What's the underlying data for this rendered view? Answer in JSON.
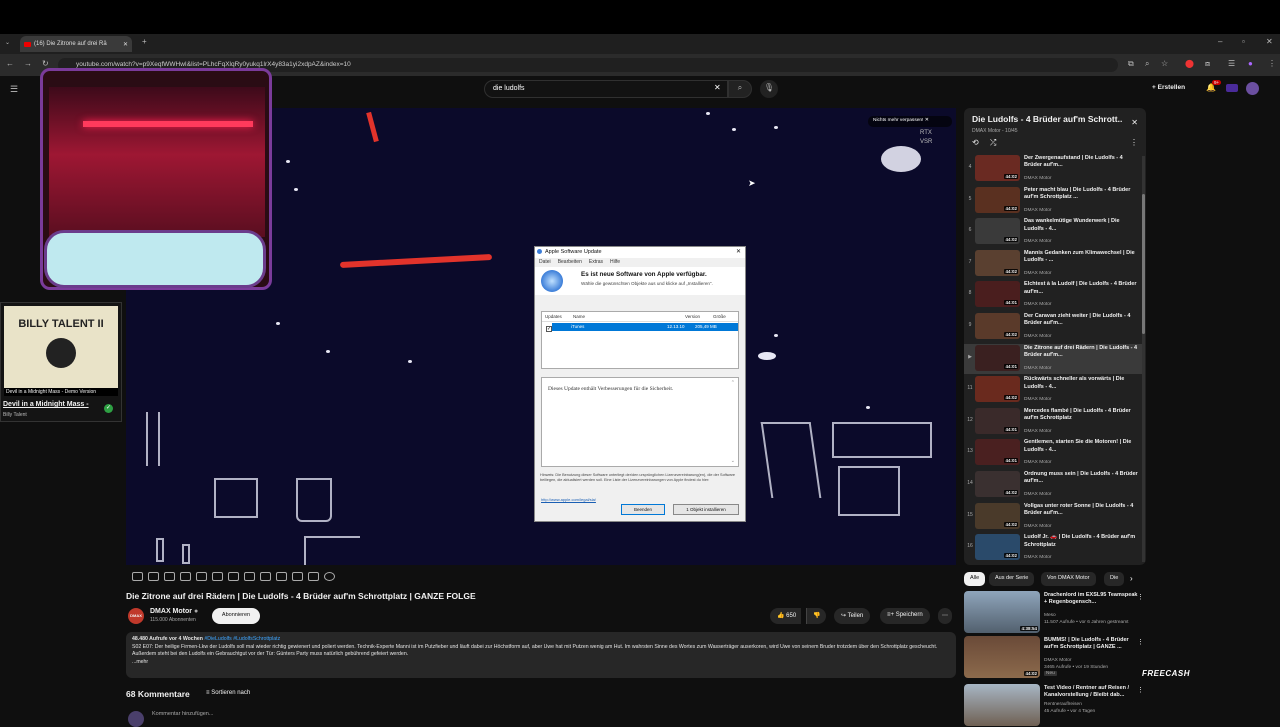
{
  "browser": {
    "tab_title": "(16) Die Zitrone auf drei Rä",
    "url": "youtube.com/watch?v=p9XeqfWWHwI&list=PLhcFqXlqRy0yukq1lrX4y83a1yi2xdpAZ&index=10"
  },
  "youtube": {
    "search_value": "die ludolfs",
    "create_label": "Erstellen",
    "notification_count": "9+"
  },
  "overlay": {
    "notify_text": "Nichts mehr verpassen!",
    "rtx_label": "RTX",
    "vsr_label": "VSR"
  },
  "music": {
    "album_text": "BILLY TALENT II",
    "track_banner": "Devil in a Midnight Mass - Demo Version",
    "track_title": "Devil in a Midnight Mass -",
    "artist": "Billy Talent"
  },
  "dialog": {
    "title": "Apple Software Update",
    "menu": [
      "Datei",
      "Bearbeiten",
      "Extras",
      "Hilfe"
    ],
    "heading": "Es ist neue Software von Apple verfügbar.",
    "subheading": "Wähle die gewünschten Objekte aus und klicke auf „Installieren“.",
    "columns": [
      "Updates",
      "Name",
      "Version",
      "Größe"
    ],
    "item": {
      "name": "iTunes",
      "version": "12.13.10",
      "size": "205,49 MB"
    },
    "description": "Dieses Update enthält Verbesserungen für die Sicherheit.",
    "note": "Hinweis: Die Benutzung dieser Software unterliegt der/den ursprünglichen Lizenzvereinbarung(en), die der Software beiliegen, die aktualisiert werden soll. Eine Liste der Lizenzvereinbarungen von Apple findest du hier:",
    "link": "http://www.apple.com/legal/sla/",
    "quit_label": "Beenden",
    "install_label": "1 Objekt installieren"
  },
  "video": {
    "title": "Die Zitrone auf drei Rädern | Die Ludolfs - 4 Brüder auf'm Schrottplatz | GANZE FOLGE",
    "channel": "DMAX Motor",
    "subscribers": "115.000 Abonnenten",
    "subscribe_label": "Abonnieren",
    "likes": "650",
    "share_label": "Teilen",
    "save_label": "Speichern",
    "views_line": "48.480 Aufrufe  vor 4 Wochen",
    "hashtags": "#DieLudolfs #LudolfsSchrottplatz",
    "description": "S02 E07: Der heilige Firmen-Lkw der Ludolfs soll mal wieder richtig gewienert und poliert werden. Technik-Experte Manni ist im Putzfieber und läuft dabei zur Höchstform auf, aber Uwe hat mit Putzen wenig am Hut. Im wahrsten Sinne des Wortes zum Wasserträger auserkoren, wird Uwe von seinem Bruder trotzdem über den Schrottplatz gescheucht. Außerdem steht bei den Ludolfs ein Gebrauchtgut vor der Tür: Günters Party muss natürlich gebührend gefeiert werden.",
    "more": "...mehr"
  },
  "comments": {
    "count": "68 Kommentare",
    "sort_label": "Sortieren nach",
    "placeholder": "Kommentar hinzufügen..."
  },
  "playlist": {
    "title": "Die Ludolfs - 4 Brüder auf'm Schrott...",
    "subtitle": "DMAX Motor - 10/45",
    "items": [
      {
        "num": "4",
        "title": "Der Zwergenaufstand | Die Ludolfs - 4 Brüder auf'm...",
        "channel": "DMAX Motor",
        "duration": "44:02"
      },
      {
        "num": "5",
        "title": "Peter macht blau | Die Ludolfs - 4 Brüder auf'm Schrottplatz ...",
        "channel": "DMAX Motor",
        "duration": "44:02"
      },
      {
        "num": "6",
        "title": "Das wankelmütige Wunderwerk | Die Ludolfs - 4...",
        "channel": "DMAX Motor",
        "duration": "44:02"
      },
      {
        "num": "7",
        "title": "Mannis Gedanken zum Klimawechsel | Die Ludolfs - ...",
        "channel": "DMAX Motor",
        "duration": "44:02"
      },
      {
        "num": "8",
        "title": "Elchtest à la Ludolf | Die Ludolfs - 4 Brüder auf'm...",
        "channel": "DMAX Motor",
        "duration": "44:01"
      },
      {
        "num": "9",
        "title": "Der Caravan zieht weiter | Die Ludolfs - 4 Brüder auf'm...",
        "channel": "DMAX Motor",
        "duration": "44:02"
      },
      {
        "num": "▶",
        "title": "Die Zitrone auf drei Rädern | Die Ludolfs - 4 Brüder auf'm...",
        "channel": "DMAX Motor",
        "duration": "44:01"
      },
      {
        "num": "11",
        "title": "Rückwärts schneller als vorwärts | Die Ludolfs - 4...",
        "channel": "DMAX Motor",
        "duration": "44:02"
      },
      {
        "num": "12",
        "title": "Mercedes flambé | Die Ludolfs - 4 Brüder auf'm Schrottplatz",
        "channel": "DMAX Motor",
        "duration": "44:01"
      },
      {
        "num": "13",
        "title": "Gentlemen, starten Sie die Motoren! | Die Ludolfs - 4...",
        "channel": "DMAX Motor",
        "duration": "44:01"
      },
      {
        "num": "14",
        "title": "Ordnung muss sein | Die Ludolfs - 4 Brüder auf'm...",
        "channel": "DMAX Motor",
        "duration": "44:02"
      },
      {
        "num": "15",
        "title": "Vollgas unter roter Sonne | Die Ludolfs - 4 Brüder auf'm...",
        "channel": "DMAX Motor",
        "duration": "44:02"
      },
      {
        "num": "16",
        "title": "Ludolf Jr. 🚗 | Die Ludolfs - 4 Brüder auf'm Schrottplatz",
        "channel": "DMAX Motor",
        "duration": "44:02"
      }
    ]
  },
  "chips": [
    "Alle",
    "Aus der Serie",
    "Von DMAX Motor",
    "Die"
  ],
  "recommendations": [
    {
      "title": "Drachenlord im EXSL95 Teamspeak + Regenbogensch...",
      "channel": "Meso",
      "meta": "11.507 Aufrufe • vor 6 Jahren gestreamt",
      "duration": "4:38:54"
    },
    {
      "title": "BUMMS! | Die Ludolfs - 4 Brüder auf'm Schrottplatz | GANZE ...",
      "channel": "DMAX Motor",
      "meta": "3465 Aufrufe • vor 19 Stunden",
      "badge": "Neu",
      "duration": "44:02"
    },
    {
      "title": "Test Video / Rentner auf Reisen / Kanalvorstellung / Bleibt dab...",
      "channel": "Rentnerauflreisen",
      "meta": "45 Aufrufe • vor 4 Tagen",
      "duration": ""
    }
  ],
  "watermark": "FREECASH",
  "colors": {
    "accent": "#ff0000",
    "dialog_selection": "#0078d7",
    "link": "#1a5fb4"
  }
}
